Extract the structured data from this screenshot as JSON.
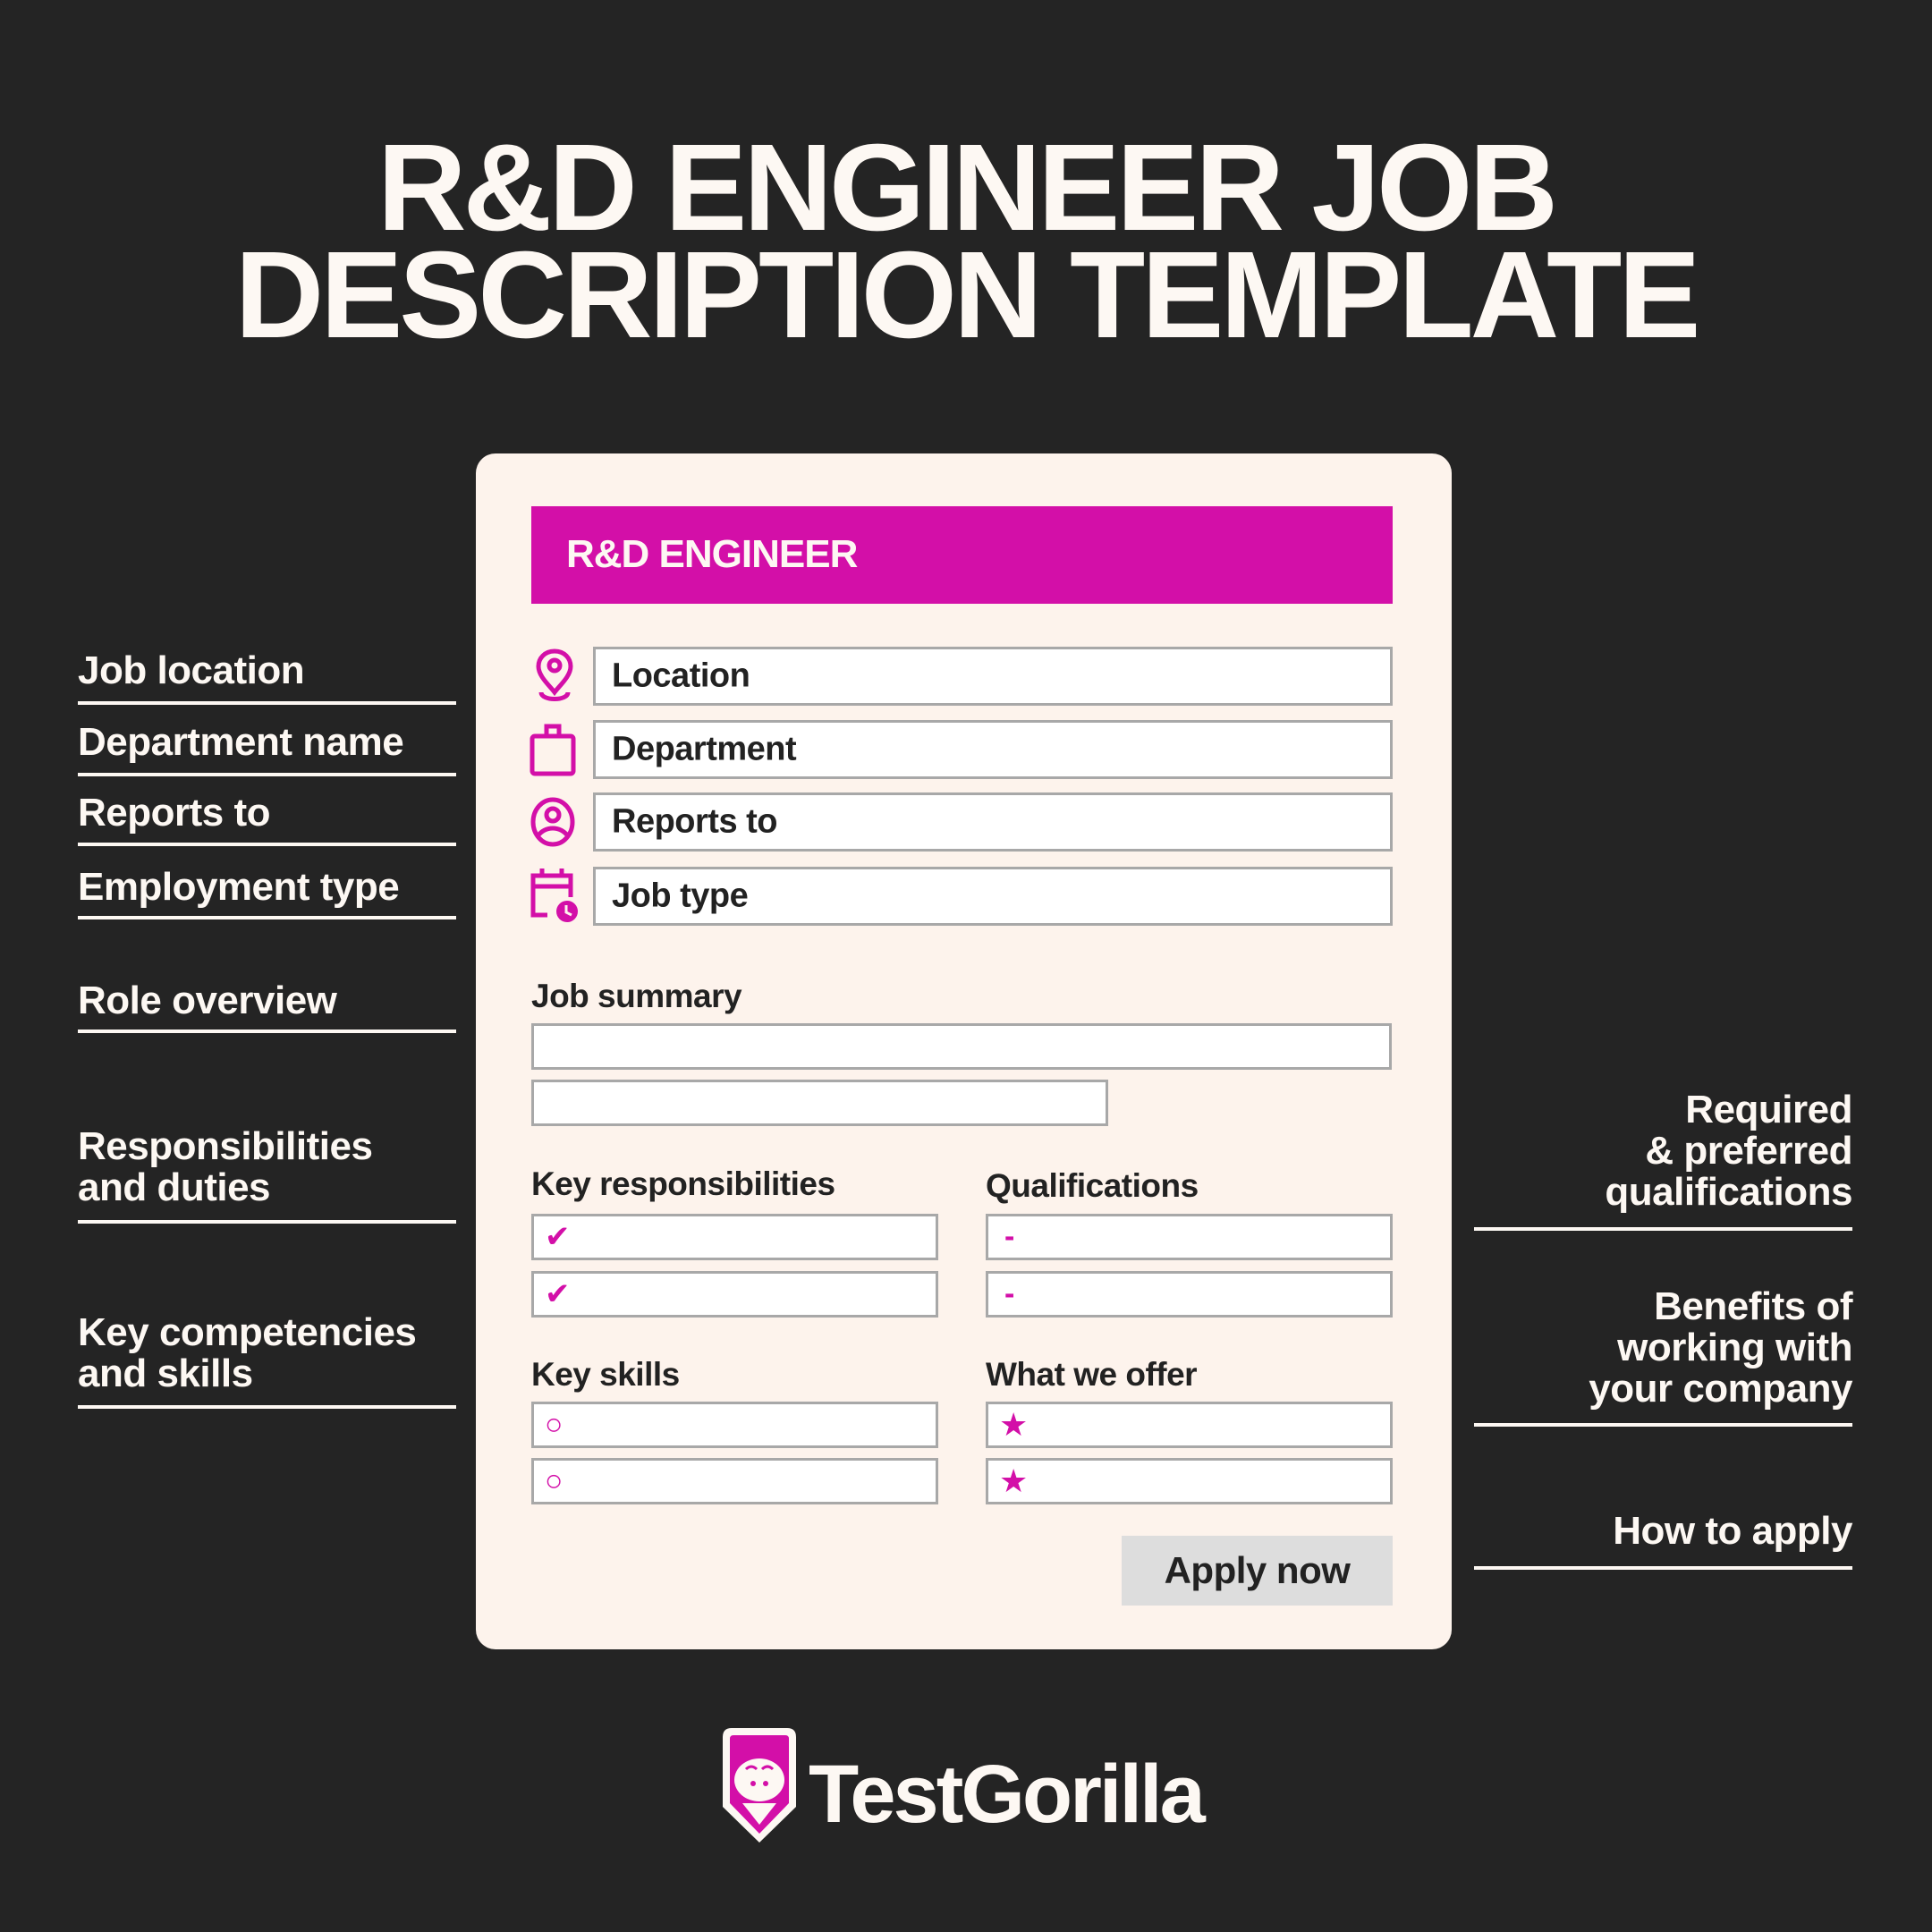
{
  "title": {
    "line1": "R&D ENGINEER JOB",
    "line2": "DESCRIPTION TEMPLATE"
  },
  "left_labels": [
    {
      "text": "Job location"
    },
    {
      "text": "Department name"
    },
    {
      "text": "Reports to"
    },
    {
      "text": "Employment type"
    },
    {
      "text": "Role overview"
    },
    {
      "line1": "Responsibilities",
      "line2": "and duties"
    },
    {
      "line1": "Key competencies",
      "line2": "and skills"
    }
  ],
  "right_labels": [
    {
      "line1": "Required",
      "line2": "& preferred",
      "line3": "qualifications"
    },
    {
      "line1": "Benefits of",
      "line2": "working with",
      "line3": "your company"
    },
    {
      "line1": "How to apply"
    }
  ],
  "card": {
    "header": "R&D ENGINEER",
    "accent_color": "#d30fa8",
    "info_fields": [
      {
        "icon": "location-pin-icon",
        "value": "Location"
      },
      {
        "icon": "briefcase-icon",
        "value": "Department"
      },
      {
        "icon": "user-circle-icon",
        "value": "Reports to"
      },
      {
        "icon": "calendar-clock-icon",
        "value": "Job type"
      }
    ],
    "job_summary_label": "Job summary",
    "key_responsibilities_label": "Key responsibilities",
    "qualifications_label": "Qualifications",
    "key_skills_label": "Key skills",
    "what_we_offer_label": "What we offer",
    "bullets": {
      "responsibility": "✔",
      "qualification": "-",
      "skill": "○",
      "offer": "★"
    },
    "apply_button": "Apply now"
  },
  "brand": {
    "name": "TestGorilla",
    "icon": "gorilla-logo-icon"
  }
}
